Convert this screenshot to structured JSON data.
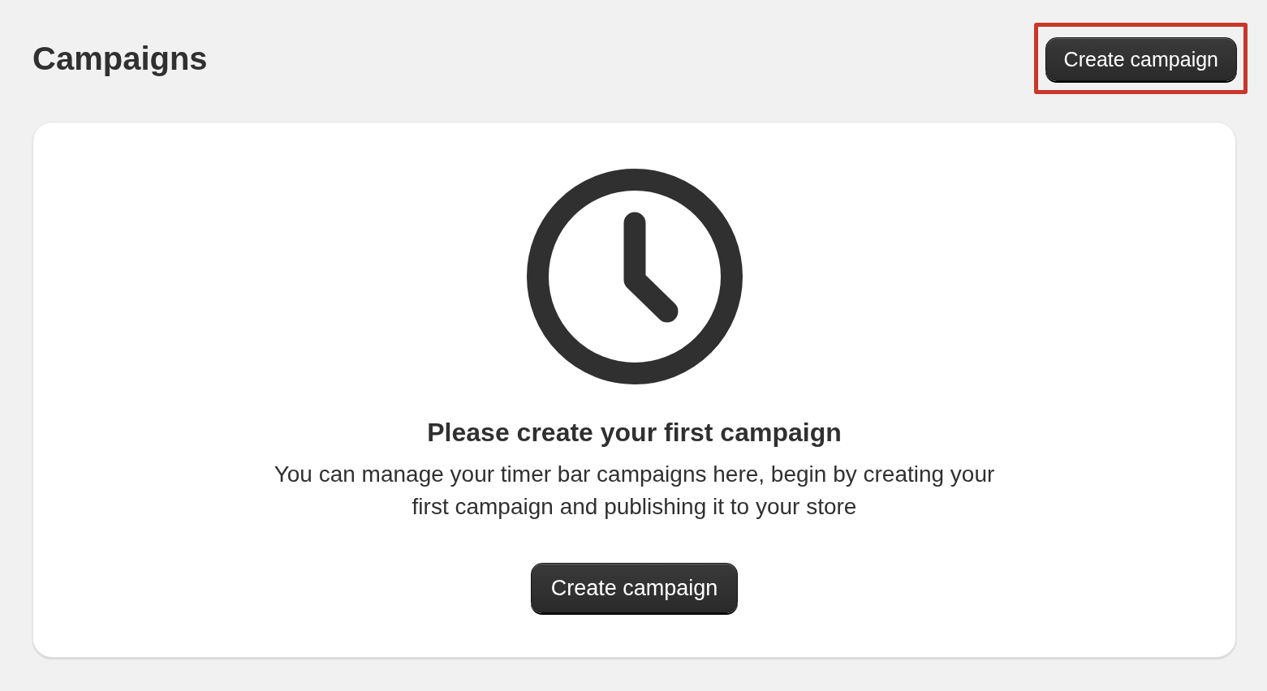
{
  "page": {
    "title": "Campaigns"
  },
  "header_button": {
    "label": "Create campaign",
    "highlighted": true
  },
  "empty_state": {
    "heading": "Please create your first campaign",
    "description": "You can manage your timer bar campaigns here, begin by creating your first campaign and publishing it to your store",
    "button": {
      "label": "Create campaign"
    }
  }
}
